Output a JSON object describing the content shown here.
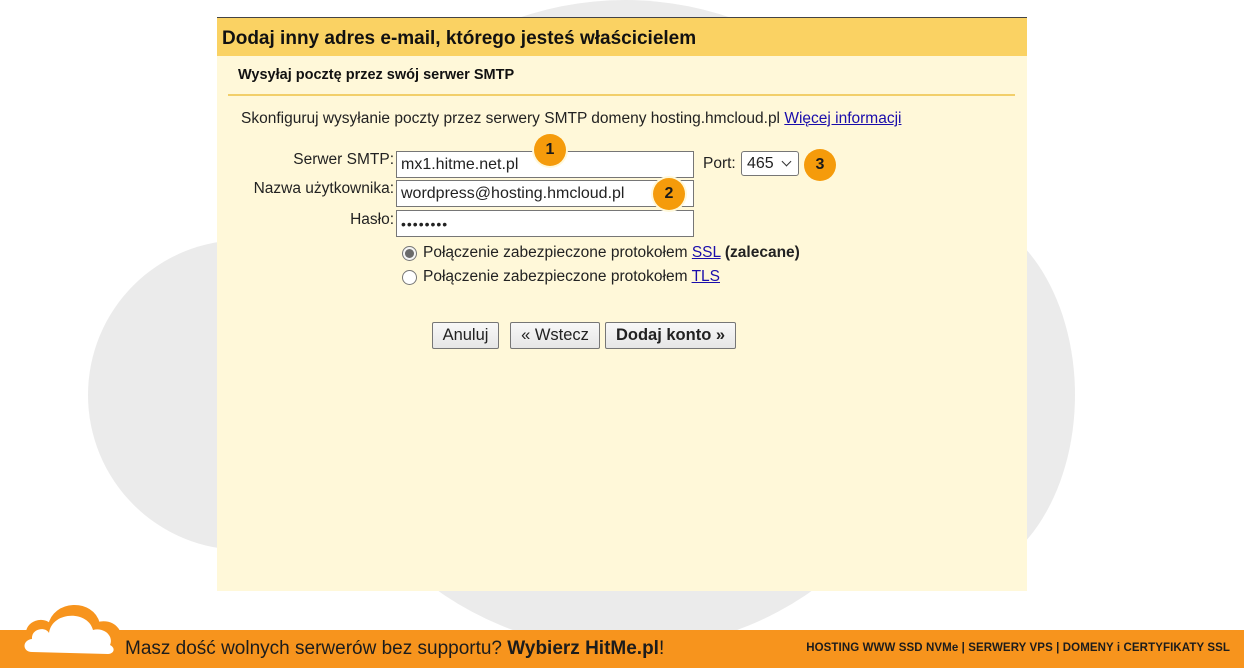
{
  "dialog": {
    "title": "Dodaj inny adres e-mail, którego jesteś właścicielem",
    "subtitle": "Wysyłaj pocztę przez swój serwer SMTP",
    "description": "Skonfiguruj wysyłanie poczty przez serwery SMTP domeny hosting.hmcloud.pl",
    "more_info_link": "Więcej informacji",
    "form": {
      "smtp_label": "Serwer SMTP:",
      "smtp_value": "mx1.hitme.net.pl",
      "port_label": "Port:",
      "port_value": "465",
      "username_label": "Nazwa użytkownika:",
      "username_value": "wordpress@hosting.hmcloud.pl",
      "password_label": "Hasło:",
      "password_value": "••••••••"
    },
    "security": {
      "ssl_option_text": "Połączenie zabezpieczone protokołem",
      "ssl_link": "SSL",
      "ssl_recommended": "(zalecane)",
      "ssl_checked": true,
      "tls_option_text": "Połączenie zabezpieczone protokołem",
      "tls_link": "TLS",
      "tls_checked": false
    },
    "buttons": {
      "cancel": "Anuluj",
      "back": "« Wstecz",
      "add_account": "Dodaj konto »"
    },
    "badges": [
      "1",
      "2",
      "3"
    ]
  },
  "footer": {
    "message_prefix": "Masz dość wolnych serwerów bez supportu?",
    "message_cta": "Wybierz HitMe.pl",
    "message_suffix": "!",
    "services": "HOSTING WWW SSD NVMe | SERWERY VPS | DOMENY i CERTYFIKATY SSL"
  },
  "colors": {
    "dialog_header": "#fad263",
    "dialog_body": "#fff8d9",
    "badge": "#f59b0b",
    "footer_bar": "#f7941d",
    "link": "#1a0dab",
    "background_cloud": "#ebebeb"
  }
}
